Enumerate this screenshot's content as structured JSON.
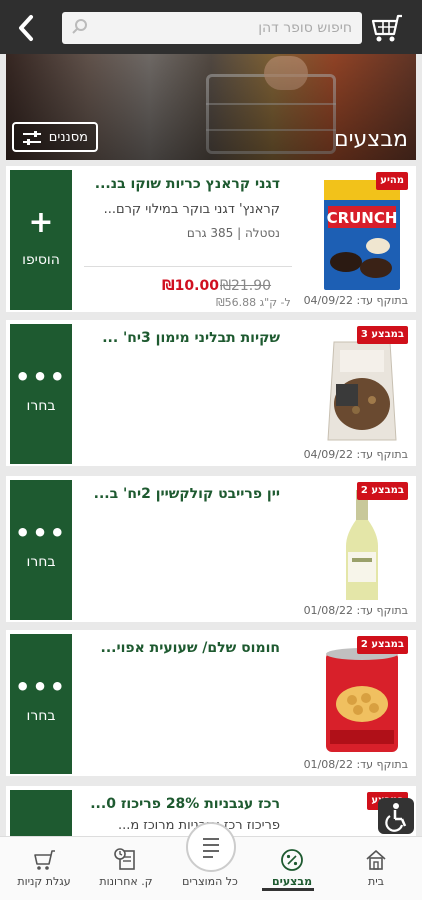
{
  "header": {
    "search_placeholder": "חיפוש סופר דהן"
  },
  "banner": {
    "title": "מבצעים",
    "filter_label": "מסננים"
  },
  "products": [
    {
      "title": "דגני קראנץ כריות שוקו בנ...",
      "desc": "קראנץ' דגני בוקר במילוי קרם...",
      "meta": "נסטלה | 385 גרם",
      "badge": "מהיע",
      "action_symbol": "+",
      "action_label": "הוסיפו",
      "price": "₪10.00",
      "old_price": "₪21.90",
      "unit_price": "₪56.88 ל- ק\"ג",
      "valid": "בתוקף עד: 04/09/22"
    },
    {
      "title": "שקיות תבליני מימון 3יח' ...",
      "badge": "3 במבצע",
      "action_label": "בחרו",
      "valid": "בתוקף עד: 04/09/22"
    },
    {
      "title": "יין פרייבט קולקשיין 2יח' ב...",
      "badge": "2 במבצע",
      "action_label": "בחרו",
      "valid": "בתוקף עד: 01/08/22"
    },
    {
      "title": "חומוס שלם/ שעועית אפוי...",
      "badge": "2 במבצע",
      "action_label": "בחרו",
      "valid": "בתוקף עד: 01/08/22"
    },
    {
      "title": "רכז עגבניות 28% פריכוז 0...",
      "desc": "פריכוז רכז עגבניות מרוכז מ...",
      "badge": "במבצע"
    }
  ],
  "bottom_nav": {
    "cart": "עגלת קניות",
    "history": "ק. אחרונות",
    "all_products": "כל המוצרים",
    "sales": "מבצעים",
    "home": "בית"
  },
  "colors": {
    "brand_green": "#1e5a30",
    "badge_red": "#d0101a",
    "topbar": "#2f2f2f"
  }
}
